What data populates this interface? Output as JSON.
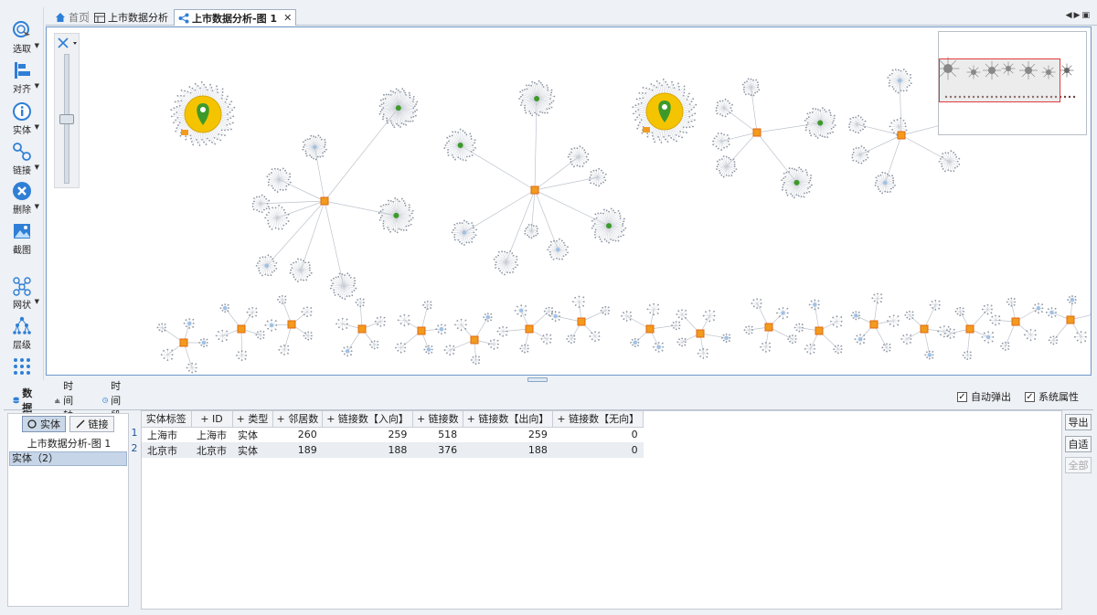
{
  "toolbar": {
    "items": [
      {
        "label": "选取",
        "icon": "cursor-icon"
      },
      {
        "label": "对齐",
        "icon": "align-icon"
      },
      {
        "label": "实体",
        "icon": "info-icon"
      },
      {
        "label": "链接",
        "icon": "link-icon"
      },
      {
        "label": "删除",
        "icon": "delete-icon"
      },
      {
        "label": "截图",
        "icon": "screenshot-icon"
      },
      {
        "label": "网状",
        "icon": "network-layout-icon"
      },
      {
        "label": "层级",
        "icon": "hierarchy-layout-icon"
      }
    ]
  },
  "tabs": [
    {
      "label": "首页",
      "icon": "home-icon",
      "active": false
    },
    {
      "label": "上市数据分析",
      "icon": "table-icon",
      "active": false
    },
    {
      "label": "上市数据分析-图 1",
      "icon": "share-icon",
      "active": true
    }
  ],
  "bottom": {
    "tabs": [
      {
        "label": "数 据",
        "icon": "data-icon"
      },
      {
        "label": "时间轴",
        "icon": "timeline-icon"
      },
      {
        "label": "时间段",
        "icon": "clock-icon"
      }
    ],
    "checkboxes": {
      "auto_popup": {
        "label": "自动弹出",
        "checked": true
      },
      "system_props": {
        "label": "系统属性",
        "checked": true
      }
    },
    "segment": {
      "entity": "实体",
      "link": "链接"
    },
    "list_title": "上市数据分析-图 1",
    "list_selected": "实体（2）",
    "buttons": {
      "export": "导出",
      "autofit": "自适",
      "all": "全部"
    }
  },
  "table": {
    "columns": [
      "实体标签",
      "+ ID",
      "+ 类型",
      "+ 邻居数",
      "+ 链接数【入向】",
      "+ 链接数",
      "+ 链接数【出向】",
      "+ 链接数【无向】"
    ],
    "rows": [
      {
        "num": "1",
        "cells": [
          "上海市",
          "上海市",
          "实体",
          "260",
          "259",
          "518",
          "259",
          "0"
        ]
      },
      {
        "num": "2",
        "cells": [
          "北京市",
          "北京市",
          "实体",
          "189",
          "188",
          "376",
          "188",
          "0"
        ]
      }
    ]
  },
  "colors": {
    "accent": "#2f7fd6",
    "canvas_border": "#6f98c8",
    "hub_yellow": "#f5c400",
    "marker_green": "#3d9a2a",
    "overview_frame": "#e03a3a"
  }
}
